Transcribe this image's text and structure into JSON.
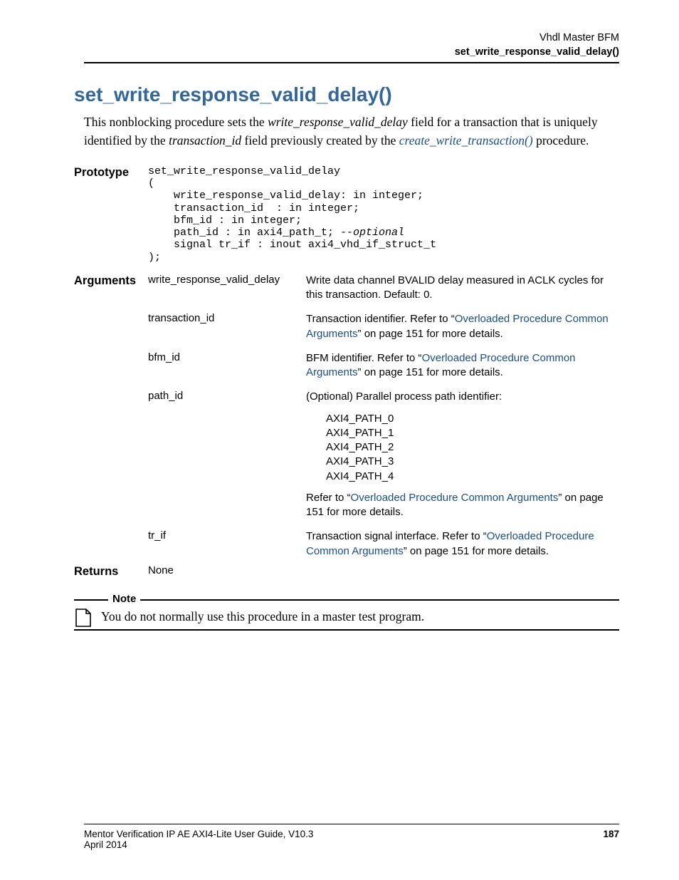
{
  "header": {
    "line1": "Vhdl Master BFM",
    "line2": "set_write_response_valid_delay()"
  },
  "title": "set_write_response_valid_delay()",
  "intro": {
    "before": "This nonblocking procedure sets the ",
    "field1": "write_response_valid_delay",
    "mid": " field for a transaction that is uniquely identified by the ",
    "field2": "transaction_id",
    "after": " field previously created by the ",
    "link": "create_write_transaction()",
    "tail": " procedure."
  },
  "sections": {
    "prototype_label": "Prototype",
    "arguments_label": "Arguments",
    "returns_label": "Returns",
    "returns_value": "None"
  },
  "code": {
    "l1": "set_write_response_valid_delay",
    "l2": "(",
    "l3": "    write_response_valid_delay: in integer;",
    "l4": "    transaction_id  : in integer;",
    "l5": "    bfm_id : in integer;",
    "l6a": "    path_id : in axi4_path_t; ",
    "l6b": "--optional",
    "l7": "    signal tr_if : inout axi4_vhd_if_struct_t",
    "l8": ");"
  },
  "args": {
    "a1": {
      "name": "write_response_valid_delay",
      "desc": "Write data channel BVALID delay measured in ACLK cycles for this transaction. Default: 0."
    },
    "a2": {
      "name": "transaction_id",
      "d_before": "Transaction identifier. Refer to “",
      "d_link": "Overloaded Procedure Common Arguments",
      "d_after": "” on page 151 for more details."
    },
    "a3": {
      "name": "bfm_id",
      "d_before": "BFM identifier. Refer to “",
      "d_link": "Overloaded Procedure Common Arguments",
      "d_after": "” on page 151 for more details."
    },
    "a4": {
      "name": "path_id",
      "desc1": "(Optional) Parallel process path identifier:",
      "p0": "AXI4_PATH_0",
      "p1": "AXI4_PATH_1",
      "p2": "AXI4_PATH_2",
      "p3": "AXI4_PATH_3",
      "p4": "AXI4_PATH_4",
      "d2_before": "Refer to “",
      "d2_link": "Overloaded Procedure Common Arguments",
      "d2_after": "” on page 151 for more details."
    },
    "a5": {
      "name": "tr_if",
      "d_before": "Transaction signal interface. Refer to “",
      "d_link": "Overloaded Procedure Common Arguments",
      "d_after": "” on page 151 for more details."
    }
  },
  "note": {
    "label": "Note",
    "text": "You do not normally use this procedure in a master test program."
  },
  "footer": {
    "left": "Mentor Verification IP AE AXI4-Lite User Guide, V10.3",
    "date": "April 2014",
    "page": "187"
  }
}
